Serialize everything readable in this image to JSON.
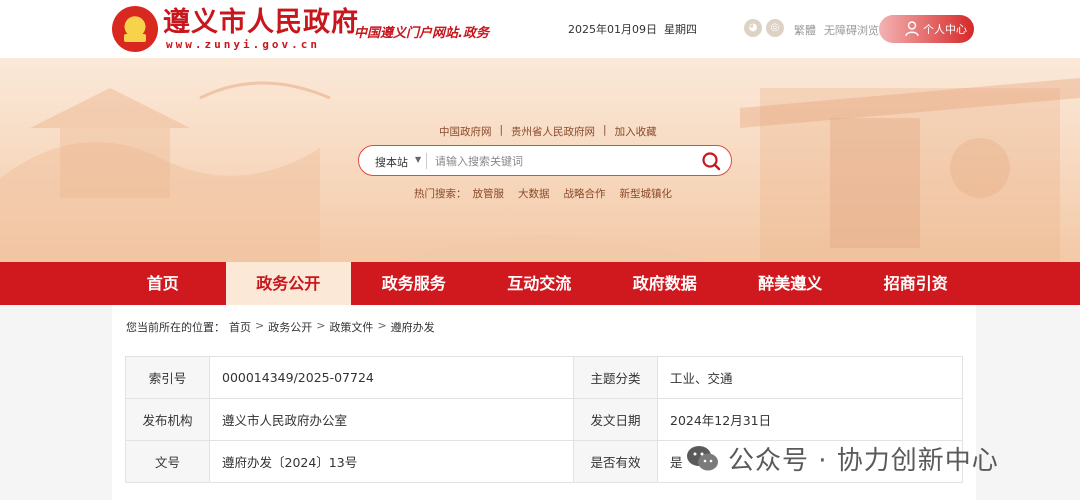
{
  "header": {
    "site_name": "遵义市人民政府",
    "site_url": "www.zunyi.gov.cn",
    "slogan": "中国遵义门户网站.政务",
    "date": "2025年01月09日",
    "weekday": "星期四",
    "links": [
      "繁體",
      "无障碍浏览"
    ],
    "user_center": "个人中心"
  },
  "banner": {
    "quick_links": [
      "中国政府网",
      "贵州省人民政府网",
      "加入收藏"
    ],
    "search": {
      "scope": "搜本站",
      "placeholder": "请输入搜索关键词"
    },
    "hot_label": "热门搜索：",
    "hot_terms": [
      "放管服",
      "大数据",
      "战略合作",
      "新型城镇化"
    ]
  },
  "nav": {
    "items": [
      "首页",
      "政务公开",
      "政务服务",
      "互动交流",
      "政府数据",
      "醉美遵义",
      "招商引资"
    ],
    "active_index": 1
  },
  "breadcrumb": {
    "prefix": "您当前所在的位置：",
    "items": [
      "首页",
      "政务公开",
      "政策文件",
      "遵府办发"
    ]
  },
  "meta_table": [
    {
      "k1": "索引号",
      "v1": "000014349/2025-07724",
      "k2": "主题分类",
      "v2": "工业、交通"
    },
    {
      "k1": "发布机构",
      "v1": "遵义市人民政府办公室",
      "k2": "发文日期",
      "v2": "2024年12月31日"
    },
    {
      "k1": "文号",
      "v1": "遵府办发〔2024〕13号",
      "k2": "是否有效",
      "v2": "是"
    }
  ],
  "watermark": {
    "text": "公众号 · 协力创新中心"
  },
  "colors": {
    "primary_red": "#d0181f",
    "brand_red": "#c8161d",
    "active_tab_bg": "#fce8d6"
  }
}
